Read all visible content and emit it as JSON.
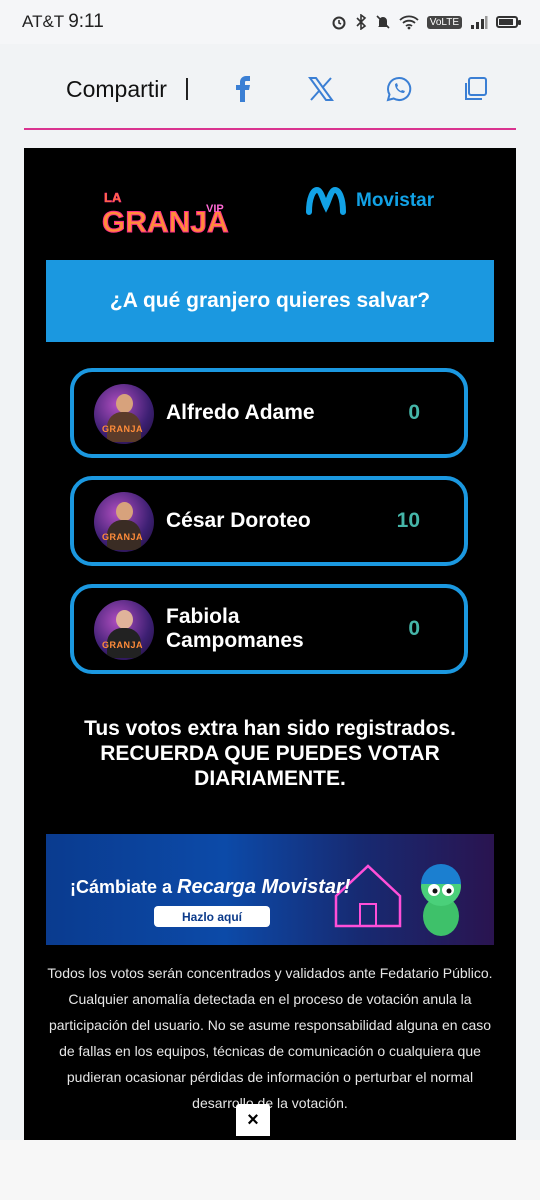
{
  "status": {
    "carrier": "AT&T",
    "time": "9:11",
    "volte": "VoLTE"
  },
  "share": {
    "label": "Compartir",
    "separator": "|"
  },
  "logos": {
    "granja_title": "LA GRANJA VIP",
    "movistar": "Movistar"
  },
  "poll": {
    "question": "¿A qué granjero quieres salvar?",
    "candidates": [
      {
        "name": "Alfredo Adame",
        "votes": "0",
        "avatar_tag": "GRANJA"
      },
      {
        "name": "César Doroteo",
        "votes": "10",
        "avatar_tag": "GRANJA"
      },
      {
        "name": "Fabiola Campomanes",
        "votes": "0",
        "avatar_tag": "GRANJA"
      }
    ],
    "message_line1": "Tus votos extra han sido registrados.",
    "message_line2": "RECUERDA QUE PUEDES VOTAR DIARIAMENTE."
  },
  "banner": {
    "prefix": "¡Cámbiate a ",
    "brand": "Recarga Movistar!",
    "cta": "Hazlo aquí"
  },
  "disclaimer": "Todos los votos serán concentrados y validados ante Fedatario Público. Cualquier anomalía detectada en el proceso de votación anula la participación del usuario. No se asume responsabilidad alguna en caso de fallas en los equipos, técnicas de comunicación o cualquiera que pudieran ocasionar pérdidas de información o perturbar el normal desarrollo de la votación.",
  "close_label": "×",
  "colors": {
    "accent_blue": "#1b98e0",
    "vote_teal": "#45b5a8",
    "rule_magenta": "#d9338f",
    "movistar_blue": "#12a2e6"
  },
  "icons": [
    "facebook-icon",
    "x-icon",
    "whatsapp-icon",
    "copy-icon"
  ]
}
